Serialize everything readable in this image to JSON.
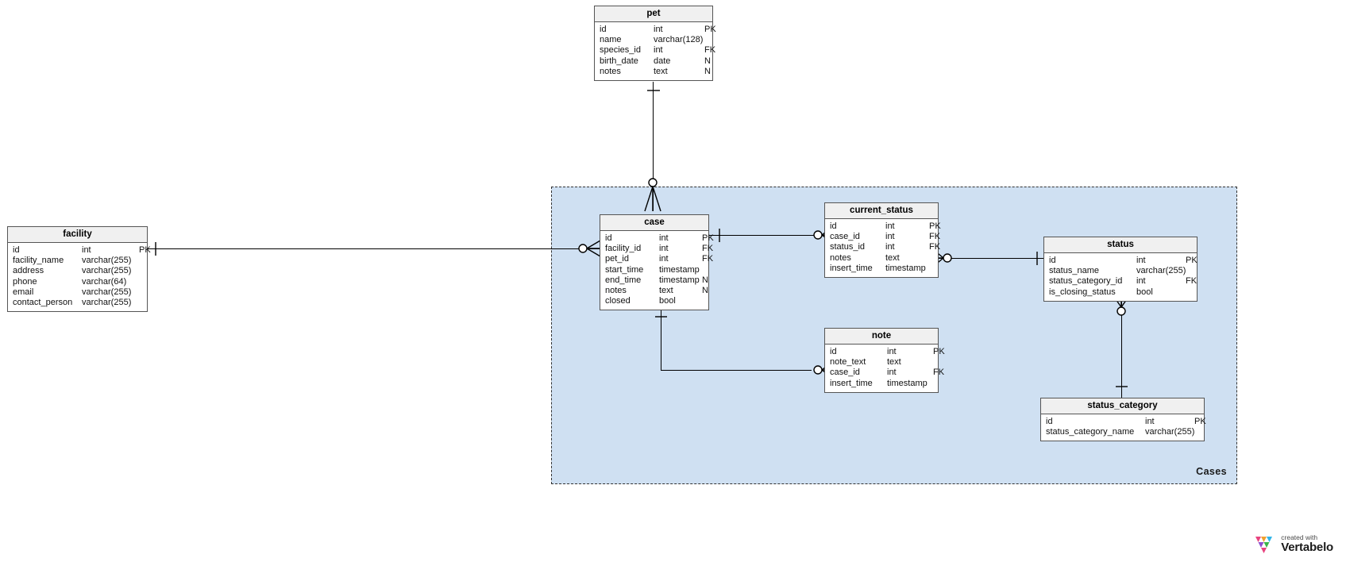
{
  "diagram": {
    "title": "Cases",
    "subject_area_label": "Cases",
    "colors": {
      "subject_area_fill": "#cfe0f2",
      "subject_area_border": "#333333",
      "entity_header_fill": "#f0f0f0",
      "entity_border": "#555555",
      "connector": "#000000"
    }
  },
  "watermark": {
    "created_with": "created with",
    "brand": "Vertabelo"
  },
  "entities": {
    "pet": {
      "name": "pet",
      "attributes": [
        {
          "name": "id",
          "type": "int",
          "key": "PK"
        },
        {
          "name": "name",
          "type": "varchar(128)",
          "key": ""
        },
        {
          "name": "species_id",
          "type": "int",
          "key": "FK"
        },
        {
          "name": "birth_date",
          "type": "date",
          "key": "N"
        },
        {
          "name": "notes",
          "type": "text",
          "key": "N"
        }
      ]
    },
    "facility": {
      "name": "facility",
      "attributes": [
        {
          "name": "id",
          "type": "int",
          "key": "PK"
        },
        {
          "name": "facility_name",
          "type": "varchar(255)",
          "key": ""
        },
        {
          "name": "address",
          "type": "varchar(255)",
          "key": ""
        },
        {
          "name": "phone",
          "type": "varchar(64)",
          "key": ""
        },
        {
          "name": "email",
          "type": "varchar(255)",
          "key": ""
        },
        {
          "name": "contact_person",
          "type": "varchar(255)",
          "key": ""
        }
      ]
    },
    "case": {
      "name": "case",
      "attributes": [
        {
          "name": "id",
          "type": "int",
          "key": "PK"
        },
        {
          "name": "facility_id",
          "type": "int",
          "key": "FK"
        },
        {
          "name": "pet_id",
          "type": "int",
          "key": "FK"
        },
        {
          "name": "start_time",
          "type": "timestamp",
          "key": ""
        },
        {
          "name": "end_time",
          "type": "timestamp",
          "key": "N"
        },
        {
          "name": "notes",
          "type": "text",
          "key": "N"
        },
        {
          "name": "closed",
          "type": "bool",
          "key": ""
        }
      ]
    },
    "current_status": {
      "name": "current_status",
      "attributes": [
        {
          "name": "id",
          "type": "int",
          "key": "PK"
        },
        {
          "name": "case_id",
          "type": "int",
          "key": "FK"
        },
        {
          "name": "status_id",
          "type": "int",
          "key": "FK"
        },
        {
          "name": "notes",
          "type": "text",
          "key": ""
        },
        {
          "name": "insert_time",
          "type": "timestamp",
          "key": ""
        }
      ]
    },
    "status": {
      "name": "status",
      "attributes": [
        {
          "name": "id",
          "type": "int",
          "key": "PK"
        },
        {
          "name": "status_name",
          "type": "varchar(255)",
          "key": ""
        },
        {
          "name": "status_category_id",
          "type": "int",
          "key": "FK"
        },
        {
          "name": "is_closing_status",
          "type": "bool",
          "key": ""
        }
      ]
    },
    "note": {
      "name": "note",
      "attributes": [
        {
          "name": "id",
          "type": "int",
          "key": "PK"
        },
        {
          "name": "note_text",
          "type": "text",
          "key": ""
        },
        {
          "name": "case_id",
          "type": "int",
          "key": "FK"
        },
        {
          "name": "insert_time",
          "type": "timestamp",
          "key": ""
        }
      ]
    },
    "status_category": {
      "name": "status_category",
      "attributes": [
        {
          "name": "id",
          "type": "int",
          "key": "PK"
        },
        {
          "name": "status_category_name",
          "type": "varchar(255)",
          "key": ""
        }
      ]
    }
  }
}
